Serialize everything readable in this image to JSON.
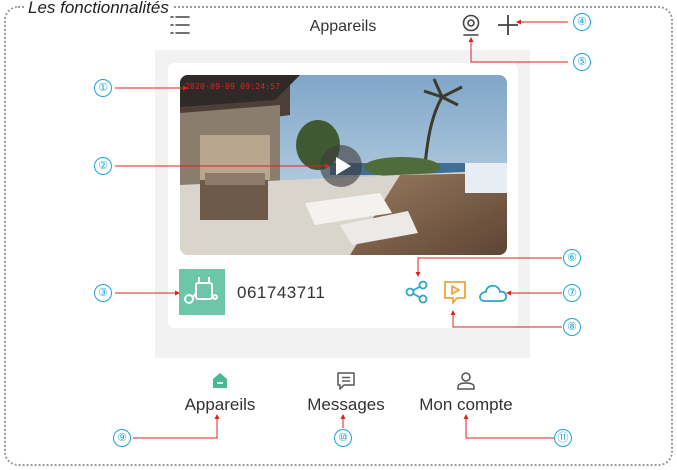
{
  "section_title": "Les fonctionnalités",
  "header": {
    "title": "Appareils",
    "menu_icon": "hamburger-menu-icon",
    "camera_icon": "camera-icon",
    "add_icon": "plus-icon"
  },
  "device": {
    "timestamp": "2020-09-09 09:24:57",
    "id": "061743711",
    "play_icon": "play-icon",
    "share_icon": "share-icon",
    "playback_icon": "playback-icon",
    "cloud_icon": "cloud-icon",
    "colors": {
      "thumb": "#6cc7a9",
      "share": "#2aa6c9",
      "playback": "#f0a43a",
      "cloud": "#2aa6c9"
    }
  },
  "nav": {
    "items": [
      {
        "label": "Appareils",
        "icon": "home-icon",
        "active": true
      },
      {
        "label": "Messages",
        "icon": "message-icon",
        "active": false
      },
      {
        "label": "Mon compte",
        "icon": "user-icon",
        "active": false
      }
    ]
  },
  "callouts": [
    "①",
    "②",
    "③",
    "④",
    "⑤",
    "⑥",
    "⑦",
    "⑧",
    "⑨",
    "⑩",
    "⑪"
  ],
  "colors": {
    "callout": "#22a3d6",
    "leader": "#e0221f",
    "active": "#4bb893"
  }
}
